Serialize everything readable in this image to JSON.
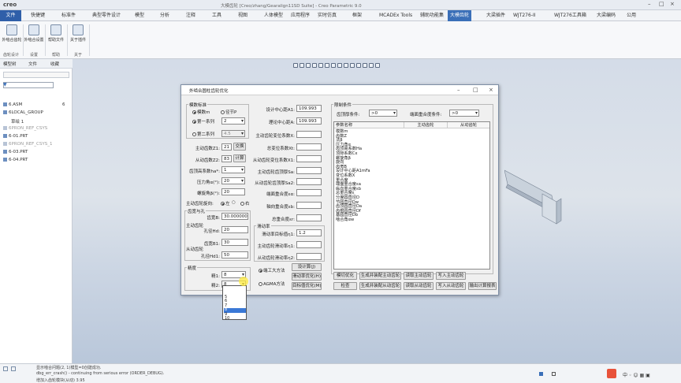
{
  "app": {
    "logo": "creo",
    "title": "大模齿轮 [Creo/zhang/Gearalign11SD Suite] - Creo Parametric 9.0"
  },
  "menu": [
    "文件",
    "快捷键",
    "标准件",
    "典型零件设计",
    "模型",
    "分析",
    "注释",
    "工具",
    "视图",
    "人体模型",
    "应用程序",
    "实时仿真",
    "框架",
    "MCADEx Tools",
    "辅助功能集",
    "大模齿轮",
    "大梁插件",
    "WJT276-II",
    "WJT276工具箱",
    "大梁编码",
    "公用"
  ],
  "menu_active": "大模齿轮",
  "ribbon": {
    "buttons": [
      {
        "label": "外啮合齿轮"
      },
      {
        "label": "外啮合设置"
      },
      {
        "label": "帮助文件"
      },
      {
        "label": "关于插件"
      }
    ],
    "groups": [
      "齿轮设计",
      "设置",
      "帮助",
      "关于"
    ]
  },
  "leftpanel": {
    "tabs": [
      "模型树",
      "文件",
      "收藏"
    ],
    "tree": [
      {
        "label": "6.ASM",
        "dim": false
      },
      {
        "label": "6LOCAL_GROUP",
        "dim": false
      },
      {
        "label": "草绘 1",
        "dim": false
      },
      {
        "label": "6PRON_REF_CSYS",
        "dim": true
      },
      {
        "label": "6-01.PRT",
        "dim": false
      },
      {
        "label": "6PRON_REF_CSYS_1",
        "dim": true
      },
      {
        "label": "6-03.PRT",
        "dim": false
      },
      {
        "label": "6-04.PRT",
        "dim": false
      }
    ],
    "count": "6"
  },
  "dialog": {
    "title": "外啮合圆柱齿轮优化",
    "module_group": "模数标准",
    "radio_m": "模数m",
    "radio_p": "径节P",
    "series1": "第一系列",
    "series1_val": "2",
    "series2": "第二系列",
    "series2_val": "4.5",
    "z1_label": "主动齿数Z1:",
    "z1_val": "21",
    "z2_label": "从动齿数Z2:",
    "z2_val": "83",
    "btn_swap": "交换",
    "btn_calc": "计算",
    "ha_label": "齿顶高系数ha*:",
    "ha_val": "1",
    "alpha_label": "压力角α(°):",
    "alpha_val": "20",
    "beta_label": "螺旋角β(°):",
    "beta_val": "20",
    "hand_label": "主动齿轮旋向:",
    "hand_left": "左",
    "hand_mid": "○",
    "hand_right": "右",
    "tooth_group": "齿宽与孔",
    "drive_label": "主动齿轮",
    "driven_label": "从动齿轮",
    "b1_label": "齿宽B:",
    "b1_val": "30.000000",
    "hd1_label": "孔径Hd:",
    "hd1_val": "20",
    "b2_label": "齿宽B1:",
    "b2_val": "30",
    "hd2_label": "孔径Hd1:",
    "hd2_val": "50",
    "prec_group": "精度",
    "prec1_label": "精1:",
    "prec1_val": "8",
    "prec2_label": "精2:",
    "prec2_val": "8",
    "dropdown": [
      "5",
      "6",
      "7",
      "8",
      "9",
      "10"
    ],
    "dropdown_sel": "8",
    "a1_label": "设计中心距A1:",
    "a1_val": "109.993",
    "a_label": "理论中心距A:",
    "a_val": "109.993",
    "x_label": "主动齿轮变位系数X:",
    "xt_label": "总变位系数Xt:",
    "x1_label": "从动齿轮变位系数X1:",
    "sa_label": "主动齿轮齿顶厚Sa:",
    "sa2_label": "从动齿轮齿顶厚Sa2:",
    "ca_label": "端面重合度εα:",
    "cb_label": "轴向重合度εb:",
    "ct_label": "总重合度εr:",
    "slip_group": "滑动率",
    "slip1_label": "滑动率目标值η1:",
    "slip1_val": "1.2",
    "slip2_label": "主动齿轮滑动率η1:",
    "slip3_label": "从动齿轮滑动率η2:",
    "method1": "端工大方法",
    "method2": "AGMA方法",
    "btn_design": "设计算(J)",
    "btn_slip": "滑动率优化(H)",
    "btn_target": "目标值优化(M)",
    "cond_group": "限制条件",
    "cond1_label": "齿顶厚条件:",
    "cond1_val": ">0",
    "cond2_label": "端面重合度条件:",
    "cond2_val": ">0",
    "list_headers": [
      "参数名称",
      "主动齿轮",
      "从动齿轮"
    ],
    "list_rows": [
      "模数m",
      "齿数Z",
      "法β",
      "压力角α",
      "齿顶高系数Ha",
      "顶隙系数Cx",
      "螺旋角β",
      "旋向",
      "齿宽B",
      "设计中心距A1mFa",
      "变位系数X",
      "重合度",
      "端面重合度εa",
      "纵向重合度εb",
      "总重合度ε",
      "分度圆直径D",
      "节圆直径Dw",
      "齿顶圆直径Da",
      "齿根圆直径Df",
      "基圆直径Db",
      "啮合角αw"
    ],
    "btn_optimize": "模切优化",
    "btn_gen_drive": "生成并装配主动齿轮",
    "btn_read_drive": "读取主动齿轮",
    "btn_write_drive": "写入主动齿轮",
    "btn_check": "检查",
    "btn_gen_driven": "生成并装配从动齿轮",
    "btn_read_driven": "读取从动齿轮",
    "btn_write_driven": "写入从动齿轮",
    "btn_report": "输出计算报表"
  },
  "status": {
    "lines": [
      "显示啮合问题(2, 1)模型=0创建成功.",
      "dbg_err_crash() - continuing from serious error (ORDER_DEBUG).",
      "增加入齿轮模块(从动)  3.95"
    ]
  }
}
